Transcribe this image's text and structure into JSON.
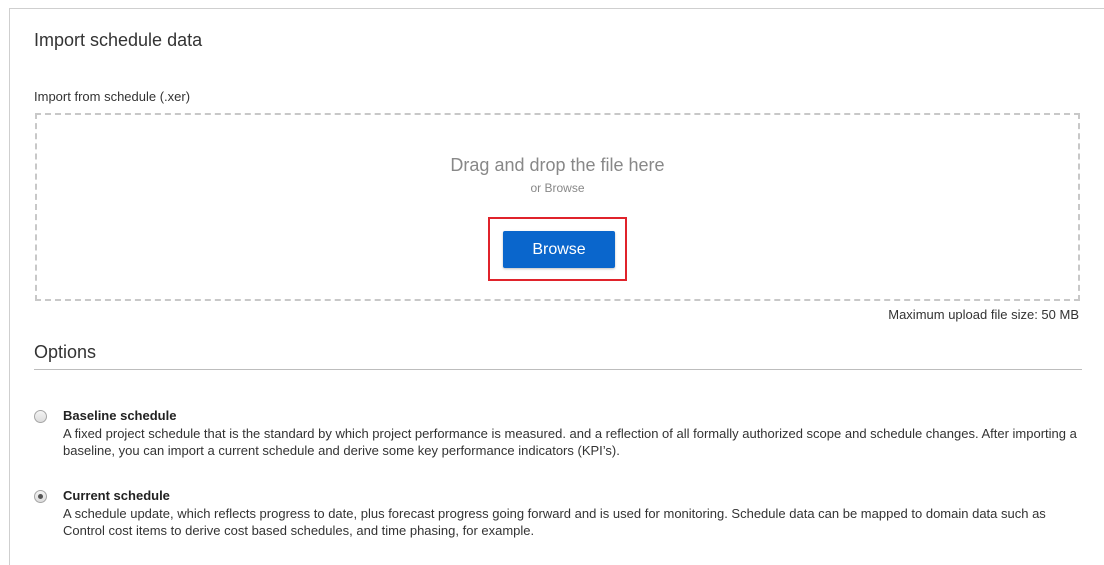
{
  "title": "Import schedule data",
  "import_label": "Import from schedule (.xer)",
  "dropzone": {
    "heading": "Drag and drop the file here",
    "subtext": "or Browse",
    "browse_label": "Browse"
  },
  "max_upload": "Maximum upload file size: 50 MB",
  "options": {
    "heading": "Options",
    "items": [
      {
        "title": "Baseline schedule",
        "description": "A fixed project schedule that is the standard by which project performance is measured. and a reflection of all formally authorized scope and schedule changes. After importing a baseline, you can import a current schedule and derive some key performance indicators (KPI’s).",
        "selected": false
      },
      {
        "title": "Current schedule",
        "description": "A schedule update, which reflects progress to date, plus forecast progress going forward and is used for monitoring. Schedule data can be mapped to domain data such as Control cost items to derive cost based schedules, and time phasing, for example.",
        "selected": true
      }
    ]
  },
  "colors": {
    "accent": "#0a66cc",
    "highlight": "#e0232b"
  }
}
